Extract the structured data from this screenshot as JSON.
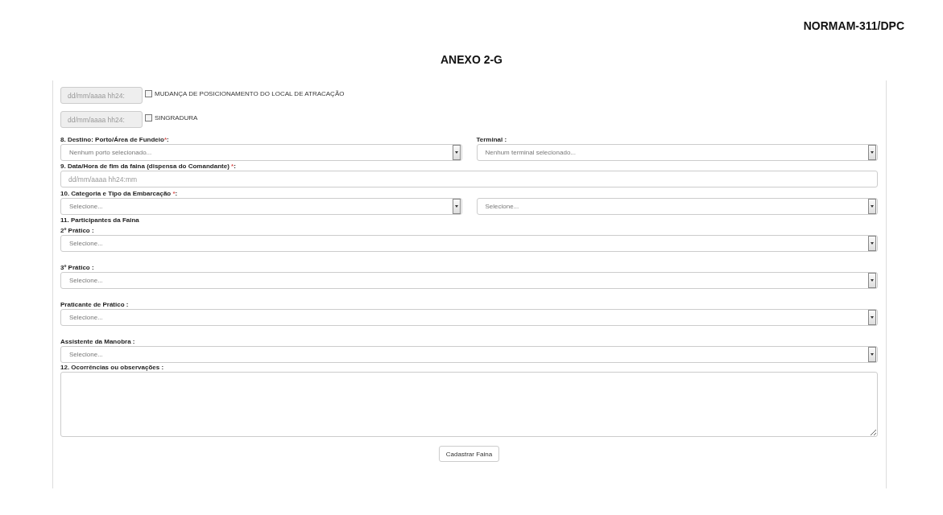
{
  "header": {
    "code": "NORMAM-311/DPC",
    "title": "ANEXO 2-G"
  },
  "checks": [
    {
      "date_placeholder": "dd/mm/aaaa hh24:",
      "disabled": true,
      "checked": false,
      "label": "MUDANÇA DE POSICIONAMENTO DO LOCAL DE ATRACAÇÃO"
    },
    {
      "date_placeholder": "dd/mm/aaaa hh24:",
      "disabled": true,
      "checked": false,
      "label": "SINGRADURA"
    }
  ],
  "fields": [
    {
      "kind": "select_pair",
      "label": {
        "text": "8. Destino: Porto/Área de Fundeio",
        "mark": "*",
        "suffix": ":"
      },
      "value": "Nenhum porto selecionado...",
      "right_label": {
        "text": "Terminal :"
      },
      "right_value": "Nenhum terminal selecionado..."
    },
    {
      "kind": "input",
      "label": {
        "text": "9. Data/Hora de fim da faina (dispensa do Comandante) ",
        "mark": "*",
        "suffix": ":"
      },
      "placeholder": "dd/mm/aaaa hh24:mm"
    },
    {
      "kind": "select_pair",
      "label": {
        "text": "10. Categoria e Tipo da Embarcação ",
        "mark": "*",
        "suffix": ":"
      },
      "value": "Selecione...",
      "right_value": "Selecione..."
    },
    {
      "kind": "heading",
      "label": {
        "text": "11. Participantes da Faina"
      }
    },
    {
      "kind": "select",
      "label": {
        "text": "2º Prático :"
      },
      "value": "Selecione..."
    },
    {
      "kind": "select",
      "label": {
        "text": "3º Prático :"
      },
      "value": "Selecione..."
    },
    {
      "kind": "select",
      "label": {
        "text": "Praticante de Prático :"
      },
      "value": "Selecione..."
    },
    {
      "kind": "select",
      "label": {
        "text": "Assistente da Manobra :"
      },
      "value": "Selecione..."
    },
    {
      "kind": "textarea",
      "label": {
        "text": "12. Ocorrências ou observações :"
      }
    }
  ],
  "submit": "Cadastrar Faina"
}
